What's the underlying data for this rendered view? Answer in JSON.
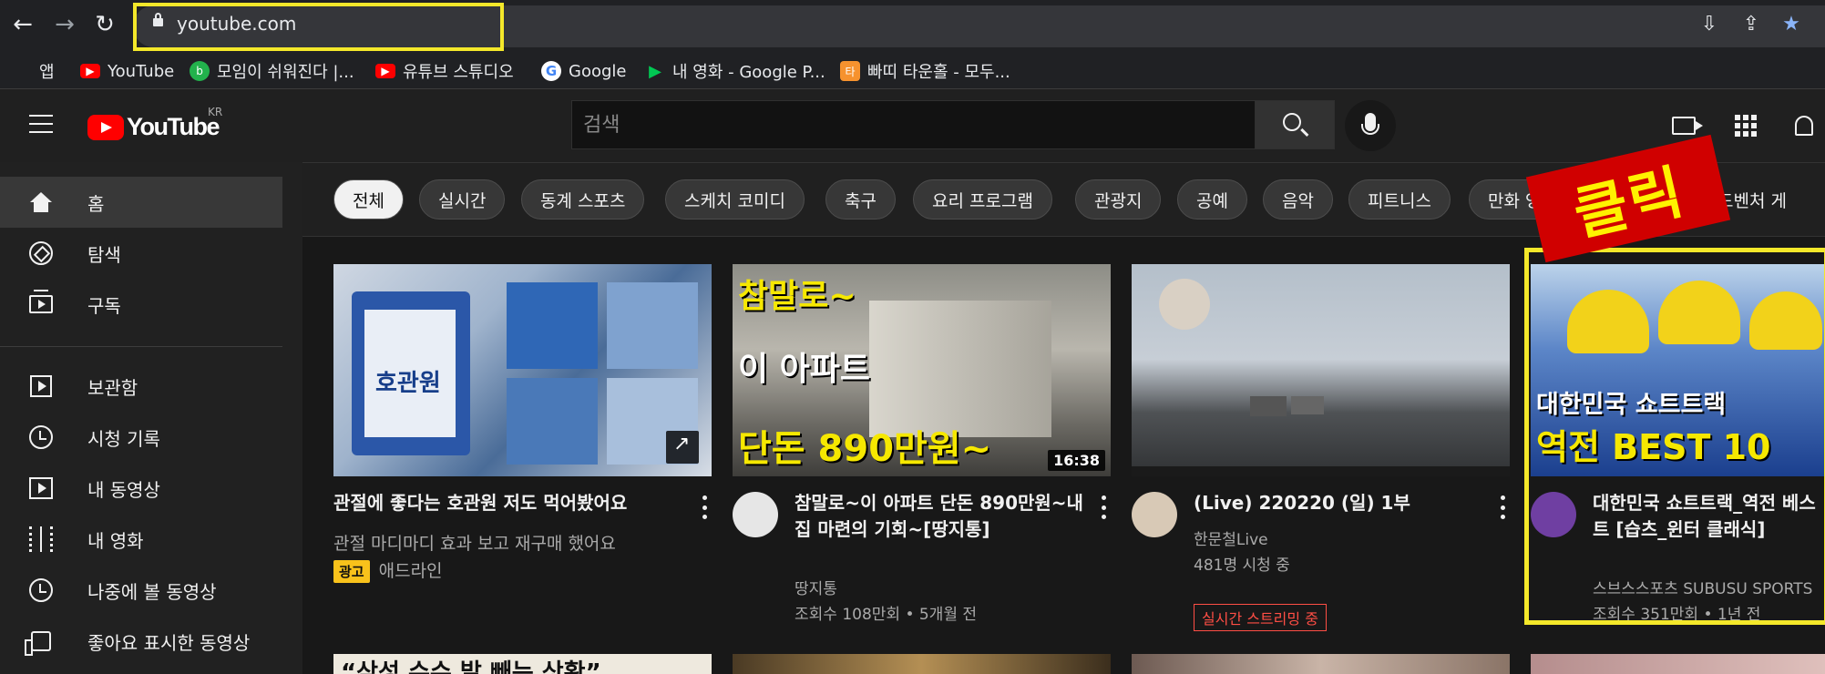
{
  "browser": {
    "url": "youtube.com",
    "bookmarks": [
      {
        "label": "앱",
        "icon": "apps-grid-icon",
        "color": "#ea4335"
      },
      {
        "label": "YouTube",
        "icon": "youtube-icon",
        "color": "#ff0000"
      },
      {
        "label": "모임이 쉬워진다 |...",
        "icon": "band-icon",
        "color": "#22b24c"
      },
      {
        "label": "유튜브 스튜디오",
        "icon": "youtube-icon",
        "color": "#ff0000"
      },
      {
        "label": "Google",
        "icon": "google-icon",
        "color": "#4285f4"
      },
      {
        "label": "내 영화 - Google P...",
        "icon": "google-play-icon",
        "color": "#00c853"
      },
      {
        "label": "빠띠 타운홀 - 모두...",
        "icon": "parti-icon",
        "color": "#f6922e"
      }
    ]
  },
  "masthead": {
    "logo_text": "YouTube",
    "country": "KR",
    "search_placeholder": "검색"
  },
  "sidebar": {
    "items": [
      {
        "label": "홈",
        "icon": "home-icon"
      },
      {
        "label": "탐색",
        "icon": "compass-icon"
      },
      {
        "label": "구독",
        "icon": "subscriptions-icon"
      },
      {
        "label": "보관함",
        "icon": "library-icon"
      },
      {
        "label": "시청 기록",
        "icon": "history-icon"
      },
      {
        "label": "내 동영상",
        "icon": "my-videos-icon"
      },
      {
        "label": "내 영화",
        "icon": "movies-icon"
      },
      {
        "label": "나중에 볼 동영상",
        "icon": "watch-later-icon"
      },
      {
        "label": "좋아요 표시한 동영상",
        "icon": "like-icon"
      }
    ]
  },
  "chips": [
    "전체",
    "실시간",
    "동계 스포츠",
    "스케치 코미디",
    "축구",
    "요리 프로그램",
    "관광지",
    "공예",
    "음악",
    "피트니스",
    "만화 영화",
    "션 어드벤처 게"
  ],
  "annotation": {
    "sticker_text": "클릭",
    "highlight_color": "#f4e82a"
  },
  "videos": [
    {
      "title": "관절에 좋다는 호관원 저도 먹어봤어요",
      "description": "관절 마디마디 효과 보고 재구매 했어요",
      "badge": "광고",
      "channel": "애드라인",
      "thumb_text": "호관원"
    },
    {
      "title": "참말로~이 아파트 단돈 890만원~내 집 마련의 기회~[땅지통]",
      "channel": "땅지통",
      "stats": "조회수 108만회 • 5개월 전",
      "duration": "16:38",
      "thumb_lines": [
        "참말로~",
        "이 아파트",
        "단돈 890만원~"
      ]
    },
    {
      "title": "(Live) 220220 (일) 1부",
      "channel": "한문철Live",
      "stats": "481명 시청 중",
      "live_badge": "실시간 스트리밍 중"
    },
    {
      "title": "대한민국 쇼트트랙_역전 베스트 [습츠_윈터 클래식]",
      "channel": "스브스스포츠 SUBUSU SPORTS",
      "stats": "조회수 351만회 • 1년 전",
      "thumb_lines": [
        "대한민국 쇼트트랙",
        "역전 BEST 10"
      ]
    }
  ],
  "row2_thumb_text": "“삼성 슈슈 발 빼는 상황”"
}
